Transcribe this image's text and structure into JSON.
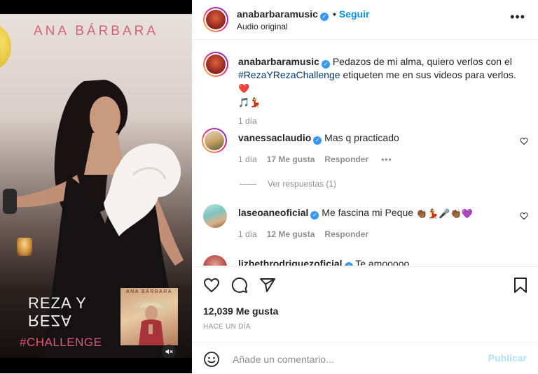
{
  "media": {
    "artist_wordmark": "ANA BÁRBARA",
    "challenge_line1": "REZA Y",
    "challenge_line2": "REZA",
    "challenge_tag": "#CHALLENGE",
    "album_title": "ANA BÁRBARA",
    "mute_icon": "muted-speaker-icon"
  },
  "header": {
    "username": "anabarbaramusic",
    "separator": "•",
    "follow_label": "Seguir",
    "audio_label": "Audio original",
    "more_label": "•••"
  },
  "caption": {
    "username": "anabarbaramusic",
    "text_before": "Pedazos de mi alma, quiero verlos con el",
    "hashtag": "#RezaYRezaChallenge",
    "text_after": "etiqueten me en sus videos para verlos.",
    "emojis_line1": "❤️",
    "emojis_line2": "🎵💃",
    "time": "1 día"
  },
  "comments": [
    {
      "username": "vanessaclaudio",
      "text": "Mas q practicado",
      "time": "1 día",
      "likes": "17 Me gusta",
      "reply_label": "Responder",
      "more_label": "•••",
      "replies_label": "Ver respuestas (1)"
    },
    {
      "username": "laseoaneoficial",
      "text": "Me fascina mi Peque",
      "emojis": "👏🏾💃🎤👏🏾💜",
      "time": "1 día",
      "likes": "12 Me gusta",
      "reply_label": "Responder"
    },
    {
      "username": "lizbethrodriguezoficial",
      "text": "Te amooooo"
    }
  ],
  "actions": {
    "likes": "12,039 Me gusta",
    "posted": "HACE UN DÍA"
  },
  "composer": {
    "placeholder": "Añade un comentario...",
    "publish_label": "Publicar"
  },
  "colors": {
    "accent_blue": "#0095f6",
    "publish_disabled": "#b2dffc",
    "hashtag": "#00376b",
    "wordmark_pink": "#d4607a"
  }
}
